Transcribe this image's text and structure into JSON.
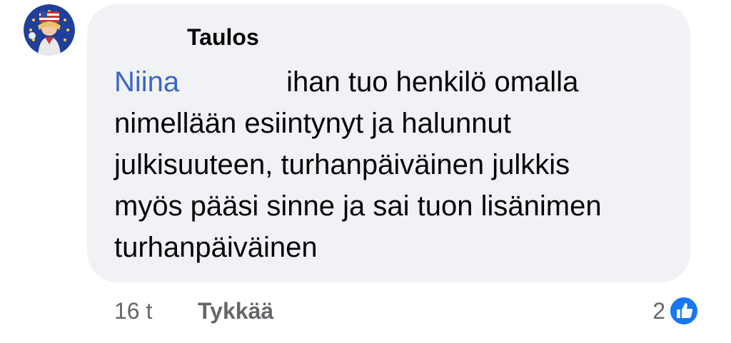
{
  "comment": {
    "author": "Taulos",
    "mention": "Niina",
    "line1_rest": "ihan tuo henkilö omalla",
    "line2": "nimellään esiintynyt ja halunnut",
    "line3": "julkisuuteen, turhanpäiväinen julkkis",
    "line4": "myös pääsi sinne ja sai tuon lisänimen",
    "line5": "turhanpäiväinen"
  },
  "footer": {
    "time": "16 t",
    "like_label": "Tykkää",
    "reaction_count": "2"
  },
  "colors": {
    "bubble": "#f0f2f5",
    "mention": "#3a66c7",
    "like_blue": "#1877f2",
    "meta_text": "#65676b"
  },
  "icons": {
    "avatar": "profile-avatar",
    "reaction": "thumbs-up-icon"
  }
}
